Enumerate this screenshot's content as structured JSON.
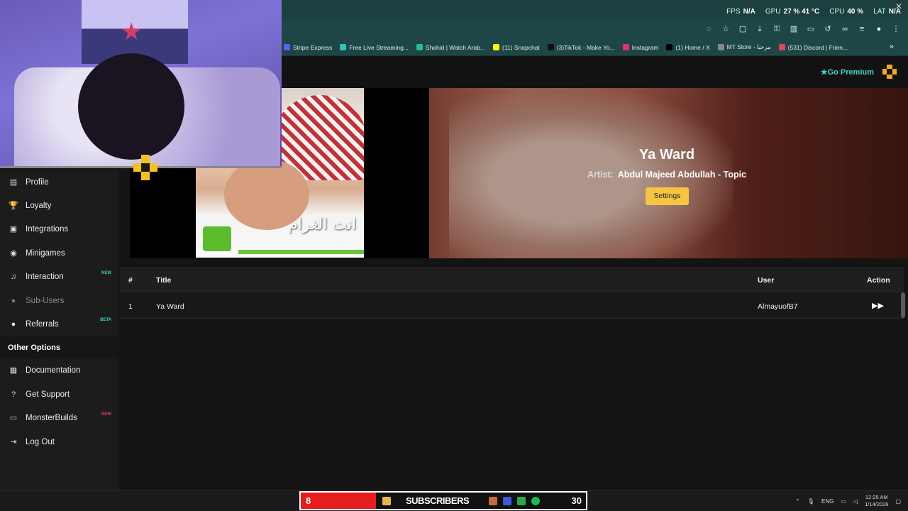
{
  "overlay": {
    "fps_label": "FPS",
    "fps_value": "N/A",
    "gpu_label": "GPU",
    "gpu_value": "27 %",
    "gpu_temp": "41 °C",
    "cpu_label": "CPU",
    "cpu_value": "40 %",
    "lat_label": "LAT",
    "lat_value": "N/A"
  },
  "bookmarks": [
    {
      "label": "Stripe Express",
      "color": "#635bff"
    },
    {
      "label": "Free Live Streaming...",
      "color": "#2ec4b6"
    },
    {
      "label": "Shahid | Watch Arab...",
      "color": "#23c28a"
    },
    {
      "label": "(11) Snapchat",
      "color": "#fffc00"
    },
    {
      "label": "(3)TikTok - Make Yo...",
      "color": "#111111"
    },
    {
      "label": "Instagram",
      "color": "#e1306c"
    },
    {
      "label": "(1) Home / X",
      "color": "#000000"
    },
    {
      "label": "MT Store - مرحبا",
      "color": "#888888"
    },
    {
      "label": "(531) Discord | Frien...",
      "color": "#e0445a"
    }
  ],
  "header": {
    "premium_label": "Go Premium"
  },
  "sidebar": {
    "items": [
      {
        "label": "Profile",
        "icon": "id-card-icon",
        "glyph": "▤"
      },
      {
        "label": "Loyalty",
        "icon": "trophy-icon",
        "glyph": "🏆"
      },
      {
        "label": "Integrations",
        "icon": "chat-icon",
        "glyph": "▣"
      },
      {
        "label": "Minigames",
        "icon": "gamepad-icon",
        "glyph": "◉"
      },
      {
        "label": "Interaction",
        "icon": "music-icon",
        "glyph": "♫",
        "tag": "NEW",
        "tag_color": "#3ad67a"
      },
      {
        "label": "Sub-Users",
        "icon": "users-icon",
        "glyph": "●",
        "dim": true
      },
      {
        "label": "Referrals",
        "icon": "user-group-icon",
        "glyph": "●",
        "tag": "BETA",
        "tag_color": "#3ad6c5"
      }
    ],
    "section_title": "Other Options",
    "other_items": [
      {
        "label": "Documentation",
        "icon": "scroll-icon",
        "glyph": "▦"
      },
      {
        "label": "Get Support",
        "icon": "question-icon",
        "glyph": "?"
      },
      {
        "label": "MonsterBuilds",
        "icon": "laptop-icon",
        "glyph": "▭",
        "tag": "NEW",
        "tag_color": "#e0445a"
      },
      {
        "label": "Log Out",
        "icon": "logout-icon",
        "glyph": "⇥"
      }
    ]
  },
  "now_playing": {
    "title": "Ya Ward",
    "artist_label": "Artist:",
    "artist": "Abdul Majeed Abdullah - Topic",
    "settings_label": "Settings",
    "cover_text": "انت الغرام"
  },
  "queue": {
    "headers": {
      "num": "#",
      "title": "Title",
      "user": "User",
      "action": "Action"
    },
    "rows": [
      {
        "num": "1",
        "title": "Ya Ward",
        "user": "AlmayuofB7"
      }
    ]
  },
  "taskbar": {
    "sub_count_left": "8",
    "sub_label": "SUBSCRIBERS",
    "sub_count_right": "30",
    "lang": "ENG",
    "time": "12:25 AM",
    "date": "1/14/2026"
  }
}
